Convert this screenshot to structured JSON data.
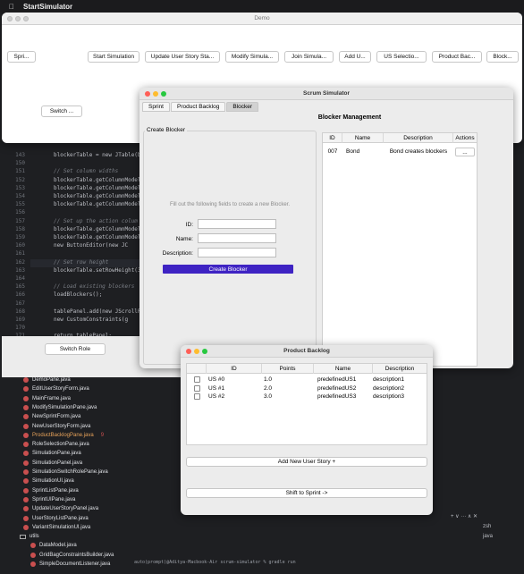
{
  "menubar": {
    "app_name": "StartSimulator"
  },
  "demo": {
    "title": "Demo",
    "buttons": [
      "Spri...",
      "Start Simulation",
      "Update User Story Sta...",
      "Modify Simula...",
      "Join Simula...",
      "Add U...",
      "US Selectio...",
      "Product Bac...",
      "Block..."
    ],
    "switch_label": "Switch ...",
    "switch_role_label": "Switch Role"
  },
  "scrum": {
    "title": "Scrum Simulator",
    "tabs": [
      "Sprint",
      "Product Backlog",
      "Blocker"
    ],
    "active_tab": "Blocker",
    "heading": "Blocker Management",
    "form": {
      "legend": "Create Blocker",
      "hint": "Fill out the following fields to create a new Blocker.",
      "id_label": "ID:",
      "name_label": "Name:",
      "description_label": "Description:",
      "id_value": "",
      "name_value": "",
      "description_value": "",
      "submit_label": "Create Blocker"
    },
    "table": {
      "columns": [
        "ID",
        "Name",
        "Description",
        "Actions"
      ],
      "rows": [
        {
          "id": "007",
          "name": "Bond",
          "description": "Bond creates blockers",
          "action": "..."
        }
      ]
    }
  },
  "backlog": {
    "title": "Product Backlog",
    "columns": [
      "",
      "ID",
      "Points",
      "Name",
      "Description"
    ],
    "rows": [
      {
        "id": "US #0",
        "points": "1.0",
        "name": "predefinedUS1",
        "description": "description1"
      },
      {
        "id": "US #1",
        "points": "2.0",
        "name": "predefinedUS2",
        "description": "description2"
      },
      {
        "id": "US #2",
        "points": "3.0",
        "name": "predefinedUS3",
        "description": "description3"
      }
    ],
    "add_label": "Add New User Story +",
    "shift_label": "Shift to Sprint ->"
  },
  "ide": {
    "code_lines": [
      {
        "n": "143",
        "t": "blockerTable = new JTable(b"
      },
      {
        "n": "150",
        "t": ""
      },
      {
        "n": "151",
        "t": "// Set column widths"
      },
      {
        "n": "152",
        "t": "blockerTable.getColumnModel"
      },
      {
        "n": "153",
        "t": "blockerTable.getColumnModel"
      },
      {
        "n": "154",
        "t": "blockerTable.getColumnModel"
      },
      {
        "n": "155",
        "t": "blockerTable.getColumnModel"
      },
      {
        "n": "156",
        "t": ""
      },
      {
        "n": "157",
        "t": "// Set up the action colum"
      },
      {
        "n": "158",
        "t": "blockerTable.getColumnModel"
      },
      {
        "n": "159",
        "t": "blockerTable.getColumnModel"
      },
      {
        "n": "160",
        "t": "    new ButtonEditor(new JC"
      },
      {
        "n": "161",
        "t": ""
      },
      {
        "n": "162",
        "t": "// Set row height"
      },
      {
        "n": "163",
        "t": "blockerTable.setRowHeight(3"
      },
      {
        "n": "164",
        "t": ""
      },
      {
        "n": "165",
        "t": "// Load existing blockers"
      },
      {
        "n": "166",
        "t": "loadBlockers();"
      },
      {
        "n": "167",
        "t": ""
      },
      {
        "n": "168",
        "t": "tablePanel.add(new JScrollP"
      },
      {
        "n": "169",
        "t": "    new CustomConstraints(g"
      },
      {
        "n": "170",
        "t": ""
      },
      {
        "n": "171",
        "t": "return tablePanel;"
      }
    ],
    "files": [
      "DemoPane.java",
      "EditUserStoryForm.java",
      "MainFrame.java",
      "ModifySimulationPane.java",
      "NewSprintForm.java",
      "NewUserStoryForm.java",
      "ProductBacklogPane.java",
      "RoleSelectionPane.java",
      "SimulationPane.java",
      "SimulationPanel.java",
      "SimulationSwitchRolePane.java",
      "SimulationUI.java",
      "SprintListPane.java",
      "SprintUIPane.java",
      "UpdateUserStoryPanel.java",
      "UserStoryListPane.java",
      "VariantSimulationUI.java"
    ],
    "modified_file": "ProductBacklogPane.java",
    "modified_badge": "9",
    "folder": "utils",
    "util_files": [
      "DataModel.java",
      "GridBagConstraintsBuilder.java",
      "SimpleDocumentListener.java"
    ],
    "terminal_items": [
      "zsh",
      "java"
    ],
    "terminal_controls": "+ ∨ ··· ∧ ✕",
    "prompt": "auto(prompt)@Aditya-Macbook-Air scrum-simulator % gradle run"
  }
}
